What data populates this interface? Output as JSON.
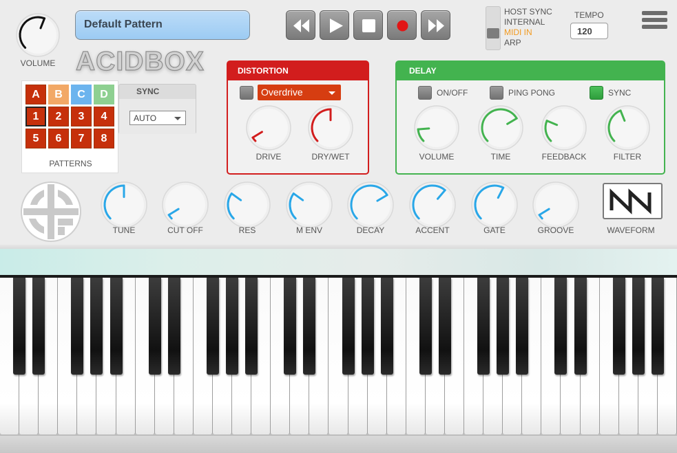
{
  "volume": {
    "label": "VOLUME",
    "value": 0.58
  },
  "pattern_name": "Default Pattern",
  "logo_text": "ACIDBOX",
  "transport": [
    {
      "name": "rewind-button",
      "icon": "rewind-icon"
    },
    {
      "name": "play-button",
      "icon": "play-icon"
    },
    {
      "name": "stop-button",
      "icon": "stop-icon"
    },
    {
      "name": "record-button",
      "icon": "record-icon"
    },
    {
      "name": "fast-forward-button",
      "icon": "fast-forward-icon"
    }
  ],
  "sync_mode": {
    "options": [
      "HOST SYNC",
      "INTERNAL",
      "MIDI IN",
      "ARP"
    ],
    "selected": "MIDI IN",
    "active_color": "#f29a1f"
  },
  "tempo": {
    "label": "TEMPO",
    "value": "120"
  },
  "patterns": {
    "label": "PATTERNS",
    "banks": [
      {
        "label": "A",
        "color": "#c6300b"
      },
      {
        "label": "B",
        "color": "#f2a866"
      },
      {
        "label": "C",
        "color": "#6cb4ee"
      },
      {
        "label": "D",
        "color": "#8ed091"
      }
    ],
    "numbers": [
      "1",
      "2",
      "3",
      "4",
      "5",
      "6",
      "7",
      "8"
    ],
    "selected_bank": "A",
    "selected_number": "1"
  },
  "sync_box": {
    "label": "SYNC",
    "value": "AUTO"
  },
  "distortion": {
    "title": "DISTORTION",
    "enabled": false,
    "type": "Overdrive",
    "color": "#d21d1d",
    "knobs": [
      {
        "label": "DRIVE",
        "value": 0.05
      },
      {
        "label": "DRY/WET",
        "value": 0.5
      }
    ]
  },
  "delay": {
    "title": "DELAY",
    "color": "#43b34f",
    "toggles": [
      {
        "label": "ON/OFF",
        "on": false
      },
      {
        "label": "PING PONG",
        "on": false
      },
      {
        "label": "SYNC",
        "on": true
      }
    ],
    "knobs": [
      {
        "label": "VOLUME",
        "value": 0.15
      },
      {
        "label": "TIME",
        "value": 0.72
      },
      {
        "label": "FEEDBACK",
        "value": 0.25
      },
      {
        "label": "FILTER",
        "value": 0.42
      }
    ]
  },
  "synth_knobs": [
    {
      "label": "TUNE",
      "value": 0.5
    },
    {
      "label": "CUT OFF",
      "value": 0.05
    },
    {
      "label": "RES",
      "value": 0.3
    },
    {
      "label": "M ENV",
      "value": 0.3
    },
    {
      "label": "DECAY",
      "value": 0.72
    },
    {
      "label": "ACCENT",
      "value": 0.65
    },
    {
      "label": "GATE",
      "value": 0.6
    },
    {
      "label": "GROOVE",
      "value": 0.05
    }
  ],
  "knob_color_synth": "#29a7e8",
  "waveform": {
    "label": "WAVEFORM",
    "icon": "sawtooth-wave-icon"
  }
}
